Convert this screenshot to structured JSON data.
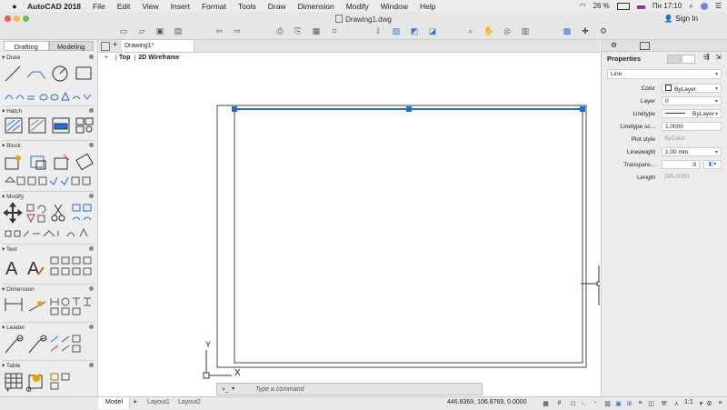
{
  "menubar": {
    "app_name": "AutoCAD 2018",
    "items": [
      "File",
      "Edit",
      "View",
      "Insert",
      "Format",
      "Tools",
      "Draw",
      "Dimension",
      "Modify",
      "Window",
      "Help"
    ],
    "battery": "26 %",
    "clock": "Пн 17:10"
  },
  "window": {
    "doc_title": "Drawing1.dwg",
    "sign_in": "Sign In"
  },
  "palette": {
    "tabs": [
      "Drafting",
      "Modeling"
    ],
    "sections": {
      "draw": "Draw",
      "hatch": "Hatch",
      "block": "Block",
      "modify": "Modify",
      "text": "Text",
      "dimension": "Dimension",
      "leader": "Leader",
      "table": "Table"
    }
  },
  "workspace": {
    "file_tab": "Drawing1*",
    "view_plus": "+",
    "view_name": "Top",
    "visual_style": "2D Wireframe",
    "ucs_x": "X",
    "ucs_y": "Y"
  },
  "properties": {
    "title": "Properties",
    "object_type": "Line",
    "rows": {
      "color": {
        "label": "Color",
        "value": "ByLayer"
      },
      "layer": {
        "label": "Layer",
        "value": "0"
      },
      "linetype": {
        "label": "Linetype",
        "value": "ByLayer"
      },
      "linetype_scale": {
        "label": "Linetype sc...",
        "value": "1.0000"
      },
      "plot_style": {
        "label": "Plot style",
        "value": "ByColor"
      },
      "lineweight": {
        "label": "Lineweight",
        "value": "1.00 mm"
      },
      "transparency": {
        "label": "Transpare...",
        "value": "0"
      },
      "length": {
        "label": "Length",
        "value": "395.0000"
      }
    }
  },
  "command": {
    "prompt_icon": ">_",
    "placeholder": "Type a command"
  },
  "status": {
    "tabs": [
      "Model",
      "Layout1",
      "Layout2"
    ],
    "add_tab": "+",
    "coords": "446.8369, 106.8769, 0.0000",
    "scale": "1:1"
  },
  "colors": {
    "accent": "#2d78d6",
    "grip": "#1f6fd6",
    "selected_line": "#1f6fd6"
  }
}
